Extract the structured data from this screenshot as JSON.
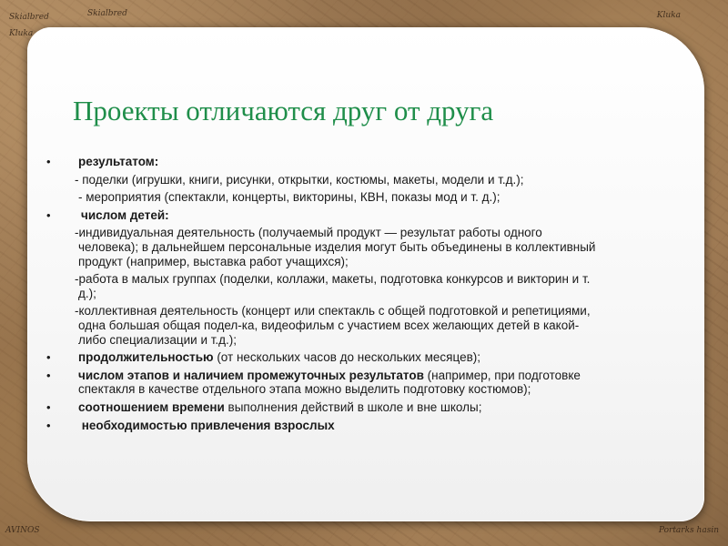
{
  "background_labels": [
    "Skialbred",
    "Skialbred",
    "Kluka",
    "Kluka",
    "AVINOS",
    "Portarks hasin"
  ],
  "title": "Проекты отличаются друг от друга",
  "items": [
    {
      "bullet": "•",
      "bold": "результатом:",
      "rest": ""
    },
    {
      "type": "sub",
      "text": "- поделки (игрушки, книги, рисунки, открытки, костюмы, макеты, модели и т.д.);"
    },
    {
      "type": "sub2",
      "text": "- мероприятия (спектакли, концерты, викторины, КВН, показы мод и т. д.);"
    },
    {
      "bullet": "•",
      "bold": "числом детей:",
      "rest": ""
    },
    {
      "type": "para",
      "lines": [
        "-индивидуальная деятельность (получаемый продукт — результат работы одного",
        "человека); в дальнейшем персональные изделия могут быть объединены в коллективный",
        "продукт (например, выставка работ учащихся);"
      ]
    },
    {
      "type": "para",
      "lines": [
        "-работа в малых группах (поделки, коллажи, макеты, подготовка конкурсов и викторин и т.",
        "д.);"
      ]
    },
    {
      "type": "para",
      "lines": [
        "-коллективная деятельность (концерт или спектакль с общей подготовкой и репетициями,",
        "одна большая общая подел-ка, видеофильм с участием всех желающих детей в какой-",
        "либо специализации и т.д.);"
      ]
    },
    {
      "bullet": "•",
      "bold": "продолжительностью",
      "rest": " (от нескольких часов до нескольких месяцев);"
    },
    {
      "bullet": "•",
      "bold": "числом этапов и наличием промежуточных результатов",
      "rest": " (например, при подготовке",
      "cont": "спектакля в качестве отдельного этапа можно выделить подготовку костюмов);"
    },
    {
      "bullet": "•",
      "bold": "соотношением времени",
      "rest": " выполнения действий в школе и вне школы;"
    },
    {
      "bullet": "•",
      "bold": " необходимостью привлечения взрослых",
      "rest": ""
    }
  ],
  "colors": {
    "title": "#1f8e4a",
    "text": "#1a1a1a",
    "card": "#ffffff"
  }
}
